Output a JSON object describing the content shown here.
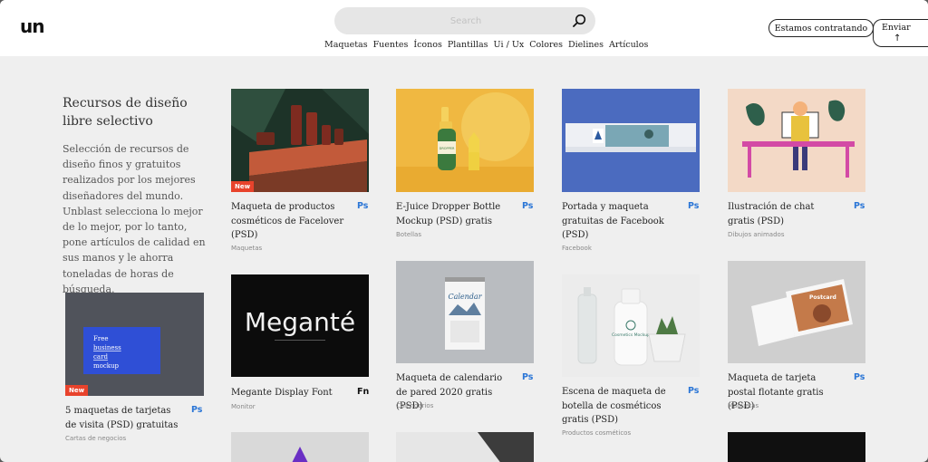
{
  "header": {
    "logo": "un",
    "search_placeholder": "Search",
    "nav": [
      "Maquetas",
      "Fuentes",
      "Íconos",
      "Plantillas",
      "Ui / Ux",
      "Colores",
      "Dielines",
      "Artículos"
    ],
    "hire_button": "Estamos contratando",
    "send_button": "Enviar",
    "send_arrow": "↑"
  },
  "intro": {
    "title": "Recursos de diseño libre selectivo",
    "description": "Selección de recursos de diseño finos y gratuitos realizados por los mejores diseñadores del mundo. Unblast selecciona lo mejor de lo mejor, por lo tanto, pone artículos de calidad en sus manos y le ahorra toneladas de horas de búsqueda."
  },
  "badge_new": "New",
  "cards": [
    {
      "title": "5 maquetas de tarjetas de visita (PSD) gratuitas",
      "app": "Ps",
      "category": "Cartas de negocios",
      "image_text": [
        "Free",
        "business",
        "card",
        "mockup"
      ]
    },
    {
      "title": "Maqueta de productos cosméticos de Facelover (PSD)",
      "app": "Ps",
      "category": "Maquetas"
    },
    {
      "title": "Megante Display Font",
      "app": "Fn",
      "category": "Monitor",
      "image_text": "Meganté"
    },
    {
      "title": "E-Juice Dropper Bottle Mockup (PSD) gratis",
      "app": "Ps",
      "category": "Botellas",
      "image_text": "DROPPER"
    },
    {
      "title": "Maqueta de calendario de pared 2020 gratis (PSD)",
      "app": "Ps",
      "category": "Calendarios",
      "image_text": "Calendar"
    },
    {
      "title": "Portada y maqueta gratuitas de Facebook (PSD)",
      "app": "Ps",
      "category": "Facebook"
    },
    {
      "title": "Escena de maqueta de botella de cosméticos gratis (PSD)",
      "app": "Ps",
      "category": "Productos cosméticos",
      "image_text": "Cosmetics Mockup"
    },
    {
      "title": "Ilustración de chat gratis (PSD)",
      "app": "Ps",
      "category": "Dibujos animados"
    },
    {
      "title": "Maqueta de tarjeta postal flotante gratis (PSD)",
      "app": "Ps",
      "category": "Maquetas",
      "image_text": "Postcard"
    }
  ]
}
